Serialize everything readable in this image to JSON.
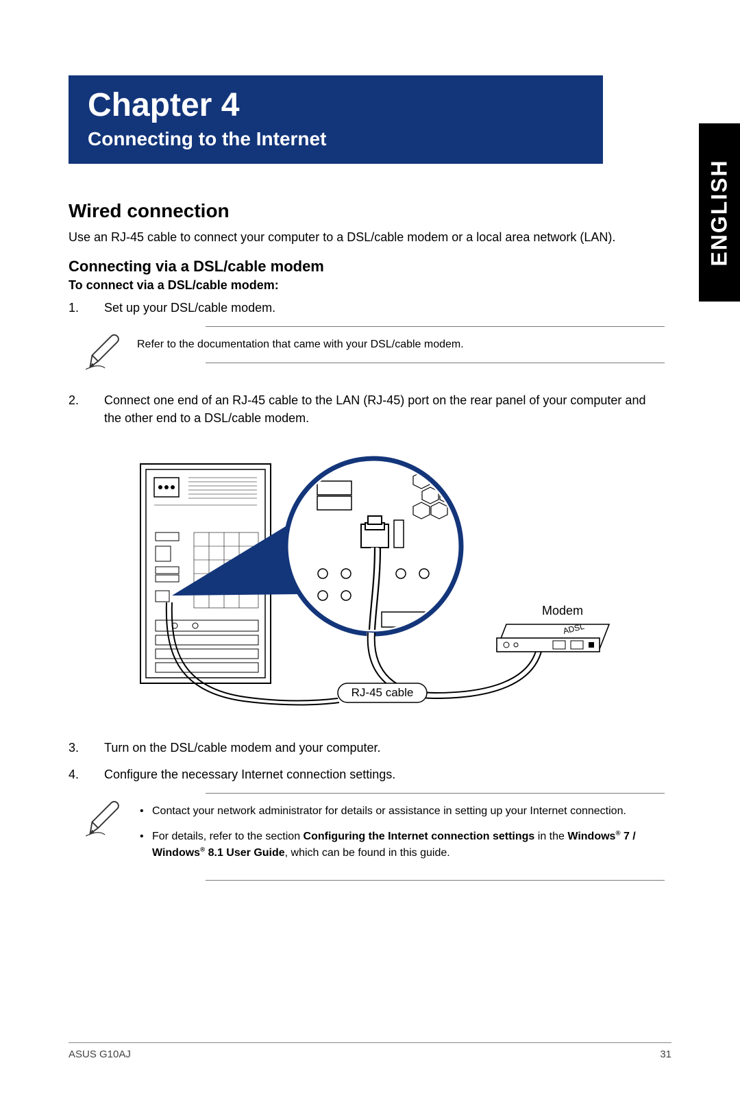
{
  "lang_tab": "ENGLISH",
  "chapter": {
    "number": "Chapter 4",
    "title": "Connecting to the Internet"
  },
  "section": {
    "title": "Wired connection",
    "intro": "Use an RJ-45 cable to connect your computer to a DSL/cable modem or a local area network (LAN).",
    "subsection_title": "Connecting via a DSL/cable modem",
    "lead_in": "To connect via a DSL/cable modem:",
    "steps": {
      "s1_num": "1.",
      "s1_text": "Set up your DSL/cable modem.",
      "s2_num": "2.",
      "s2_text": "Connect one end of an RJ-45 cable to the LAN (RJ-45) port on the rear panel of your computer and the other end to a DSL/cable modem.",
      "s3_num": "3.",
      "s3_text": "Turn on the DSL/cable modem and your computer.",
      "s4_num": "4.",
      "s4_text": "Configure the necessary Internet connection settings."
    },
    "note1": "Refer to the documentation that came with your DSL/cable modem.",
    "note2a": "Contact your network administrator for details or assistance in setting up your Internet connection.",
    "note2b_pre": "For details, refer to the section ",
    "note2b_bold1": "Configuring the Internet connection settings",
    "note2b_mid": " in the ",
    "note2b_bold2_a": "Windows",
    "note2b_bold2_b": " 7 / Windows",
    "note2b_bold2_c": " 8.1 User Guide",
    "note2b_post": ", which can be found in this guide."
  },
  "diagram": {
    "label_modem": "Modem",
    "label_cable": "RJ-45 cable",
    "label_adsl": "ADSL"
  },
  "footer": {
    "left": "ASUS G10AJ",
    "right": "31"
  }
}
